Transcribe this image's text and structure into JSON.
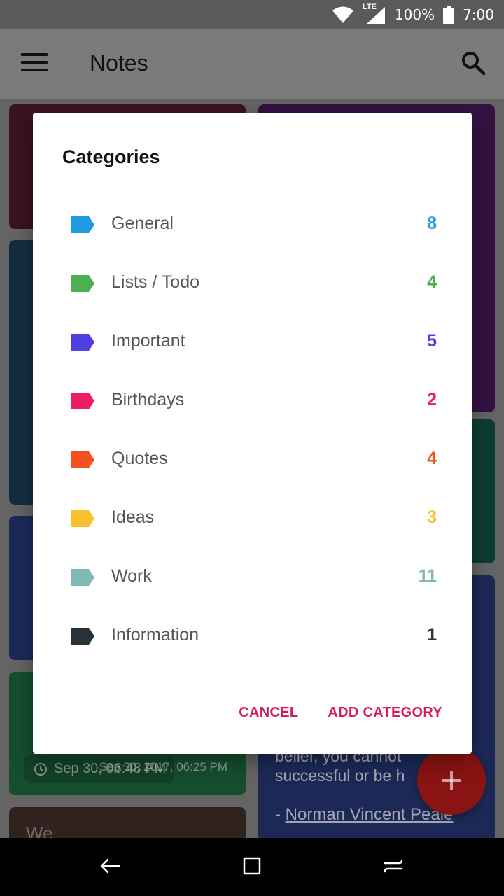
{
  "status_bar": {
    "network": "LTE",
    "battery": "100%",
    "time": "7:00"
  },
  "app_bar": {
    "title": "Notes"
  },
  "background_notes": {
    "quote_text_line1": "belief, you cannot",
    "quote_text_line2": "successful or be h",
    "quote_author_prefix": "- ",
    "quote_author": "Norman Vincent Peale",
    "reminder_chip": "Sep 30, 06:48 PM",
    "note_meta": "Sep 30, 2017, 06:25 PM",
    "partial_title": "We"
  },
  "dialog": {
    "title": "Categories",
    "categories": [
      {
        "label": "General",
        "count": "8",
        "color": "#1e9be0"
      },
      {
        "label": "Lists / Todo",
        "count": "4",
        "color": "#4caf50"
      },
      {
        "label": "Important",
        "count": "5",
        "color": "#4f3fe0"
      },
      {
        "label": "Birthdays",
        "count": "2",
        "color": "#e91e63"
      },
      {
        "label": "Quotes",
        "count": "4",
        "color": "#f4511e"
      },
      {
        "label": "Ideas",
        "count": "3",
        "color": "#fbc02d"
      },
      {
        "label": "Work",
        "count": "11",
        "color": "#80b9b4"
      },
      {
        "label": "Information",
        "count": "1",
        "color": "#263238"
      }
    ],
    "cancel_label": "CANCEL",
    "add_label": "ADD CATEGORY"
  },
  "colors": {
    "accent": "#d81b60",
    "fab": "#8a1313"
  },
  "icons": {
    "menu": "menu-icon",
    "search": "search-icon",
    "fab": "plus-icon",
    "back": "back-icon",
    "home": "home-icon",
    "recents": "recents-icon"
  }
}
